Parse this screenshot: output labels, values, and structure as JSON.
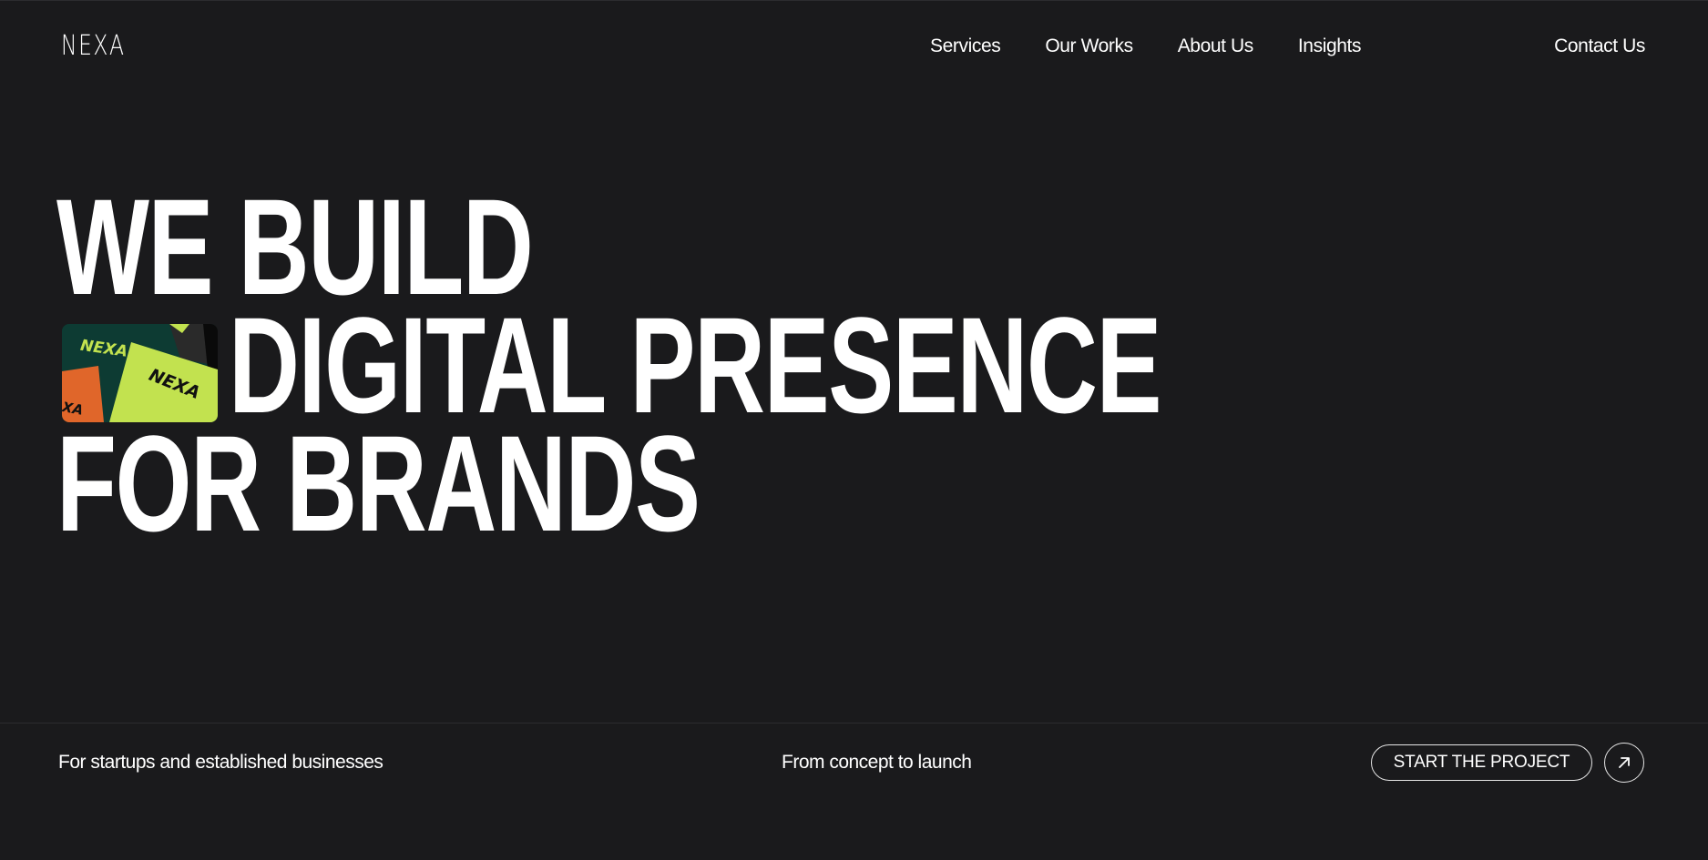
{
  "header": {
    "logo": "NEXA",
    "nav": [
      "Services",
      "Our Works",
      "About Us",
      "Insights"
    ],
    "contact": "Contact Us"
  },
  "hero": {
    "line1": "WE BUILD",
    "line2": "DIGITAL PRESENCE",
    "line3": "FOR BRANDS",
    "thumb_text": [
      "NEXA",
      "NEXA",
      "XA"
    ]
  },
  "footer": {
    "tagline_left": "For startups and established businesses",
    "tagline_mid": "From concept to launch",
    "cta_label": "START THE PROJECT",
    "cta_icon": "arrow-up-right-icon"
  },
  "colors": {
    "background": "#1a1a1c",
    "text": "#ffffff",
    "thumb_green": "#0d3b33",
    "thumb_lime": "#c2e24f",
    "thumb_orange": "#e0662a"
  }
}
